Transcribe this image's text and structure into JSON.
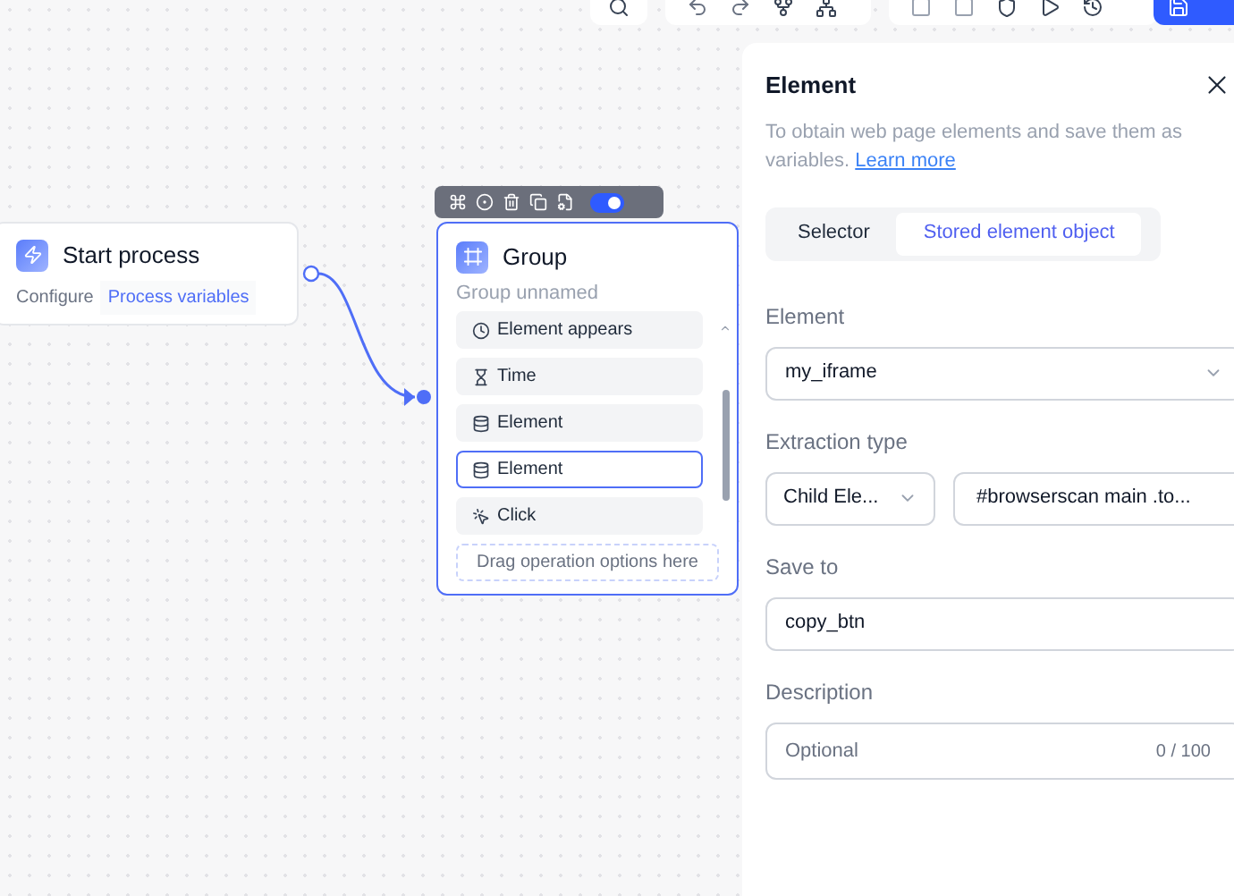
{
  "canvas": {
    "start_node": {
      "title": "Start process",
      "configure_label": "Configure",
      "variables_link": "Process variables"
    },
    "group_node": {
      "toolbar": {
        "enabled": true
      },
      "title": "Group",
      "subtitle": "Group unnamed",
      "steps": [
        {
          "kind": "wait-element",
          "label": "Element appears",
          "selected": false
        },
        {
          "kind": "wait-time",
          "label": "Time",
          "selected": false
        },
        {
          "kind": "element",
          "label": "Element",
          "selected": false
        },
        {
          "kind": "element",
          "label": "Element",
          "selected": true
        },
        {
          "kind": "click",
          "label": "Click",
          "selected": false
        }
      ],
      "drop_hint": "Drag operation options here"
    }
  },
  "panel": {
    "title": "Element",
    "description": "To obtain web page elements and save them as variables.",
    "learn_more": "Learn more",
    "tabs": [
      {
        "label": "Selector",
        "selected": false
      },
      {
        "label": "Stored element object",
        "selected": true
      }
    ],
    "element": {
      "label": "Element",
      "value": "my_iframe"
    },
    "extraction": {
      "label": "Extraction type",
      "type_value": "Child Ele...",
      "selector_value": "#browserscan main .to..."
    },
    "save_to": {
      "label": "Save to",
      "value": "copy_btn"
    },
    "description_field": {
      "label": "Description",
      "placeholder": "Optional",
      "counter": "0 / 100"
    }
  }
}
